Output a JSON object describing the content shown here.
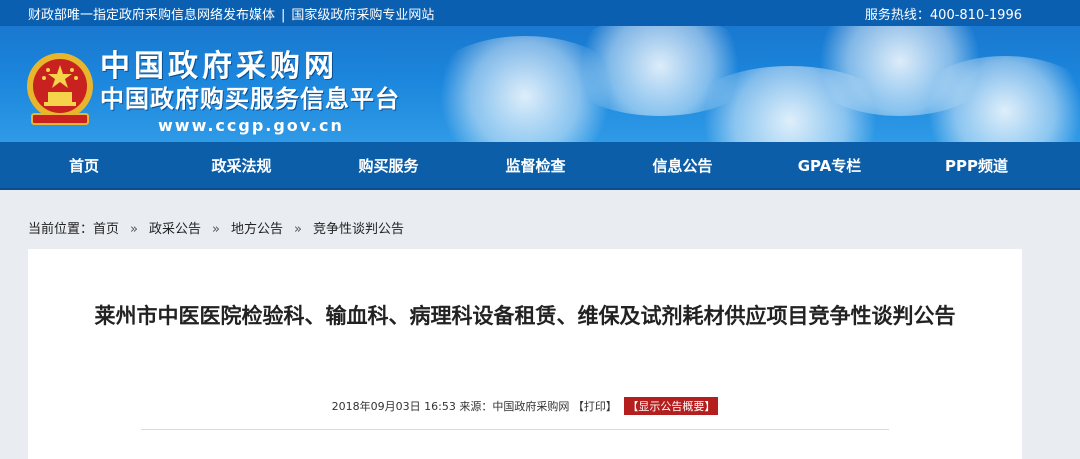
{
  "topbar": {
    "left_1": "财政部唯一指定政府采购信息网络发布媒体",
    "left_2": "国家级政府采购专业网站",
    "hotline": "服务热线：400-810-1996"
  },
  "brand": {
    "name": "中国政府采购网",
    "subtitle": "中国政府购买服务信息平台",
    "url": "www.ccgp.gov.cn",
    "emblem_icon": "national-emblem-icon"
  },
  "nav": {
    "items": [
      "首页",
      "政采法规",
      "购买服务",
      "监督检查",
      "信息公告",
      "GPA专栏",
      "PPP频道"
    ]
  },
  "breadcrumb": {
    "prefix": "当前位置：",
    "items": [
      "首页",
      "政采公告",
      "地方公告",
      "竞争性谈判公告"
    ],
    "separator": "»"
  },
  "article": {
    "title": "莱州市中医医院检验科、输血科、病理科设备租赁、维保及试剂耗材供应项目竞争性谈判公告",
    "date": "2018年09月03日  16:53",
    "source": "来源：中国政府采购网",
    "print_label": "【打印】",
    "summary_label": "【显示公告概要】"
  },
  "colors": {
    "topbar": "#0a5fb0",
    "nav": "#0d5ea8",
    "summary": "#b41e1e"
  }
}
